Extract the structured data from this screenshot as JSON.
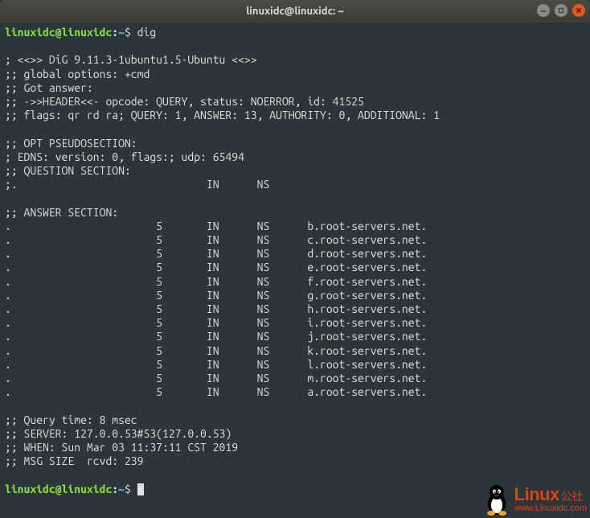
{
  "titlebar": {
    "title": "linuxidc@linuxidc: ~"
  },
  "prompt": {
    "user_host": "linuxidc@linuxidc",
    "path": "~",
    "symbol": "$"
  },
  "command": "dig",
  "output": {
    "version_line": "; <<>> DiG 9.11.3-1ubuntu1.5-Ubuntu <<>>",
    "global_options": ";; global options: +cmd",
    "got_answer": ";; Got answer:",
    "header": ";; ->>HEADER<<- opcode: QUERY, status: NOERROR, id: 41525",
    "flags": ";; flags: qr rd ra; QUERY: 1, ANSWER: 13, AUTHORITY: 0, ADDITIONAL: 1",
    "opt_header": ";; OPT PSEUDOSECTION:",
    "edns": "; EDNS: version: 0, flags:; udp: 65494",
    "question_header": ";; QUESTION SECTION:",
    "question_line": ";.                              IN      NS",
    "answer_header": ";; ANSWER SECTION:",
    "answers": [
      ".                       5       IN      NS      b.root-servers.net.",
      ".                       5       IN      NS      c.root-servers.net.",
      ".                       5       IN      NS      d.root-servers.net.",
      ".                       5       IN      NS      e.root-servers.net.",
      ".                       5       IN      NS      f.root-servers.net.",
      ".                       5       IN      NS      g.root-servers.net.",
      ".                       5       IN      NS      h.root-servers.net.",
      ".                       5       IN      NS      i.root-servers.net.",
      ".                       5       IN      NS      j.root-servers.net.",
      ".                       5       IN      NS      k.root-servers.net.",
      ".                       5       IN      NS      l.root-servers.net.",
      ".                       5       IN      NS      m.root-servers.net.",
      ".                       5       IN      NS      a.root-servers.net."
    ],
    "query_time": ";; Query time: 8 msec",
    "server": ";; SERVER: 127.0.0.53#53(127.0.0.53)",
    "when": ";; WHEN: Sun Mar 03 11:37:11 CST 2019",
    "msg_size": ";; MSG SIZE  rcvd: 239"
  },
  "watermark": {
    "brand": "Linux",
    "sub": "公社",
    "url": "www.Linuxidc.com"
  }
}
